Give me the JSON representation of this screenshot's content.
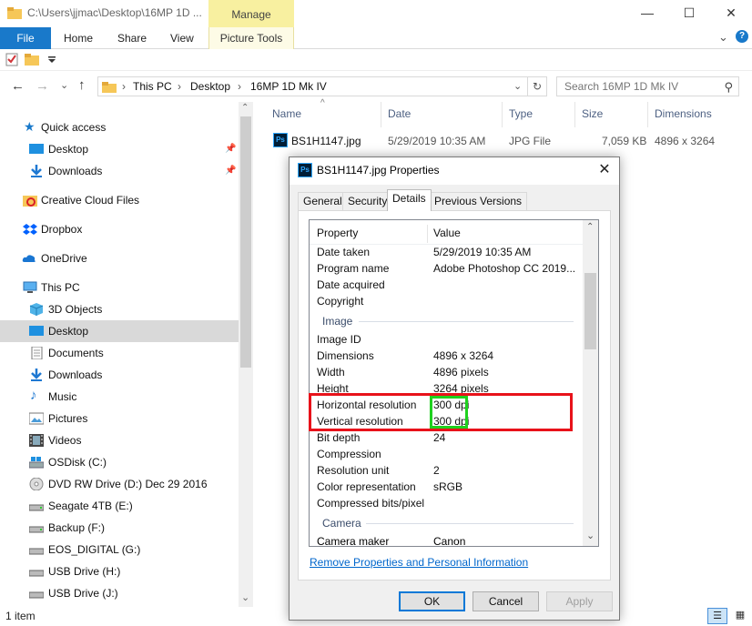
{
  "window": {
    "title": "C:\\Users\\jjmac\\Desktop\\16MP 1D ...",
    "manage_label": "Manage",
    "minimize": "—",
    "maximize": "☐",
    "close": "✕"
  },
  "ribbon": {
    "tabs": [
      "File",
      "Home",
      "Share",
      "View",
      "Picture Tools"
    ],
    "expand_icon": "⌄",
    "help_icon": "?"
  },
  "address": {
    "back": "←",
    "forward": "→",
    "history": "⌄",
    "up": "↑",
    "crumbs": [
      "This PC",
      "Desktop",
      "16MP 1D Mk IV"
    ],
    "separator": "›",
    "dropdown": "⌄",
    "refresh": "↻",
    "search_placeholder": "Search 16MP 1D Mk IV",
    "search_icon": "⚲"
  },
  "nav": {
    "items": [
      {
        "label": "Quick access",
        "icon": "star-icon"
      },
      {
        "label": "Desktop",
        "icon": "desktop-icon"
      },
      {
        "label": "Downloads",
        "icon": "download-icon"
      },
      {
        "label": "Creative Cloud Files",
        "icon": "creative-cloud-icon"
      },
      {
        "label": "Dropbox",
        "icon": "dropbox-icon"
      },
      {
        "label": "OneDrive",
        "icon": "onedrive-icon"
      },
      {
        "label": "This PC",
        "icon": "computer-icon"
      },
      {
        "label": "3D Objects",
        "icon": "cube-icon"
      },
      {
        "label": "Desktop",
        "icon": "desktop-icon"
      },
      {
        "label": "Documents",
        "icon": "document-icon"
      },
      {
        "label": "Downloads",
        "icon": "download-icon"
      },
      {
        "label": "Music",
        "icon": "music-icon"
      },
      {
        "label": "Pictures",
        "icon": "pictures-icon"
      },
      {
        "label": "Videos",
        "icon": "video-icon"
      },
      {
        "label": "OSDisk (C:)",
        "icon": "drive-icon"
      },
      {
        "label": "DVD RW Drive (D:) Dec 29 2016",
        "icon": "dvd-icon"
      },
      {
        "label": "Seagate 4TB (E:)",
        "icon": "drive-icon"
      },
      {
        "label": "Backup (F:)",
        "icon": "drive-icon"
      },
      {
        "label": "EOS_DIGITAL (G:)",
        "icon": "drive-icon"
      },
      {
        "label": "USB Drive (H:)",
        "icon": "drive-icon"
      },
      {
        "label": "USB Drive (J:)",
        "icon": "drive-icon"
      }
    ],
    "pin_glyph": "📌",
    "scroll_up": "⌃",
    "scroll_down": "⌄"
  },
  "filelist": {
    "columns": [
      "Name",
      "Date",
      "Type",
      "Size",
      "Dimensions"
    ],
    "sort_glyph": "^",
    "rows": [
      {
        "name": "BS1H1147.jpg",
        "date": "5/29/2019 10:35 AM",
        "type": "JPG File",
        "size": "7,059 KB",
        "dimensions": "4896 x 3264"
      }
    ]
  },
  "status": {
    "item_count": "1 item",
    "details_view_icon": "☰",
    "tiles_view_icon": "▦"
  },
  "dialog": {
    "title": "BS1H1147.jpg Properties",
    "close": "✕",
    "tabs": [
      "General",
      "Security",
      "Details",
      "Previous Versions"
    ],
    "header": {
      "property": "Property",
      "value": "Value"
    },
    "rows_top": [
      {
        "property": "Date taken",
        "value": "5/29/2019 10:35 AM"
      },
      {
        "property": "Program name",
        "value": "Adobe Photoshop CC 2019..."
      },
      {
        "property": "Date acquired",
        "value": ""
      },
      {
        "property": "Copyright",
        "value": ""
      }
    ],
    "group_image": "Image",
    "rows_image": [
      {
        "property": "Image ID",
        "value": ""
      },
      {
        "property": "Dimensions",
        "value": "4896 x 3264"
      },
      {
        "property": "Width",
        "value": "4896 pixels"
      },
      {
        "property": "Height",
        "value": "3264 pixels"
      },
      {
        "property": "Horizontal resolution",
        "value": "300 dpi"
      },
      {
        "property": "Vertical resolution",
        "value": "300 dpi"
      },
      {
        "property": "Bit depth",
        "value": "24"
      },
      {
        "property": "Compression",
        "value": ""
      },
      {
        "property": "Resolution unit",
        "value": "2"
      },
      {
        "property": "Color representation",
        "value": "sRGB"
      },
      {
        "property": "Compressed bits/pixel",
        "value": ""
      }
    ],
    "group_camera": "Camera",
    "rows_camera": [
      {
        "property": "Camera maker",
        "value": "Canon"
      }
    ],
    "scroll_up": "⌃",
    "scroll_down": "⌄",
    "remove_link": "Remove Properties and Personal Information",
    "buttons": {
      "ok": "OK",
      "cancel": "Cancel",
      "apply": "Apply"
    }
  },
  "colors": {
    "accent": "#1979ca",
    "highlight_red": "#e8121a",
    "highlight_green": "#1fd11f",
    "manage_yellow": "#f8f0a0"
  }
}
